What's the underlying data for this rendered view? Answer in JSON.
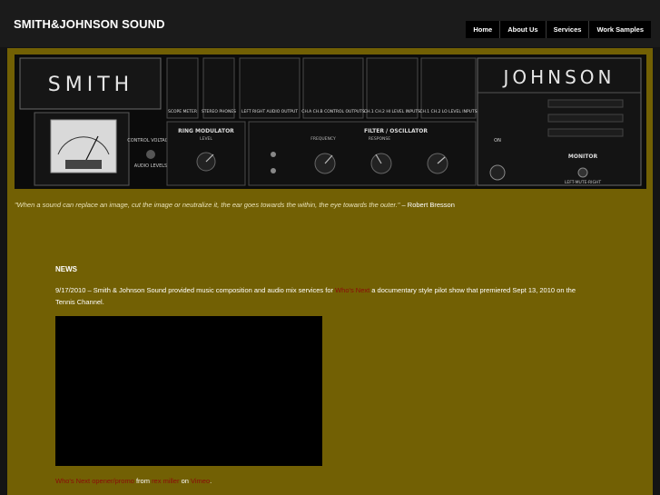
{
  "site": {
    "title": "SMITH&JOHNSON SOUND"
  },
  "nav": [
    "Home",
    "About Us",
    "Services",
    "Work Samples"
  ],
  "banner": {
    "brand_left": "SMITH",
    "brand_right": "JOHNSON",
    "labels": {
      "scope_meter": "SCOPE METER",
      "stereo_phones": "STEREO PHONES",
      "audio_output": "LEFT RIGHT AUDIO OUTPUT",
      "control_outputs": "CH.A CH.B CONTROL OUTPUTS",
      "hi_level_inputs": "CH.1 CH.2 HI LEVEL INPUTS",
      "lo_level_inputs": "CH.1 CH.2 LO LEVEL INPUTS",
      "ring_modulator": "RING MODULATOR",
      "level": "LEVEL",
      "filter": "FILTER / OSCILLATOR",
      "frequency": "FREQUENCY",
      "response": "RESPONSE",
      "control_voltages": "CONTROL VOLTAGES",
      "audio_levels": "AUDIO LEVELS",
      "on": "ON",
      "monitor": "MONITOR",
      "left_mute_right": "LEFT-MUTE-RIGHT"
    }
  },
  "quote": {
    "text": "\"When a sound can replace an image, cut the image or neutralize it, the ear goes towards the within, the eye towards the outer.\"",
    "author": " – Robert Bresson"
  },
  "news": {
    "title": "NEWS",
    "body_before": "9/17/2010 – Smith & Johnson Sound provided music composition and audio mix services for ",
    "link": "Who's Next",
    "body_after": " a documentary style pilot show that premiered Sept 13, 2010 on the Tennis Channel."
  },
  "caption": {
    "link1": "Who's Next opener/promo",
    "from": " from ",
    "link2": "rex miller",
    "on": " on ",
    "link3": "Vimeo",
    "end": "."
  }
}
